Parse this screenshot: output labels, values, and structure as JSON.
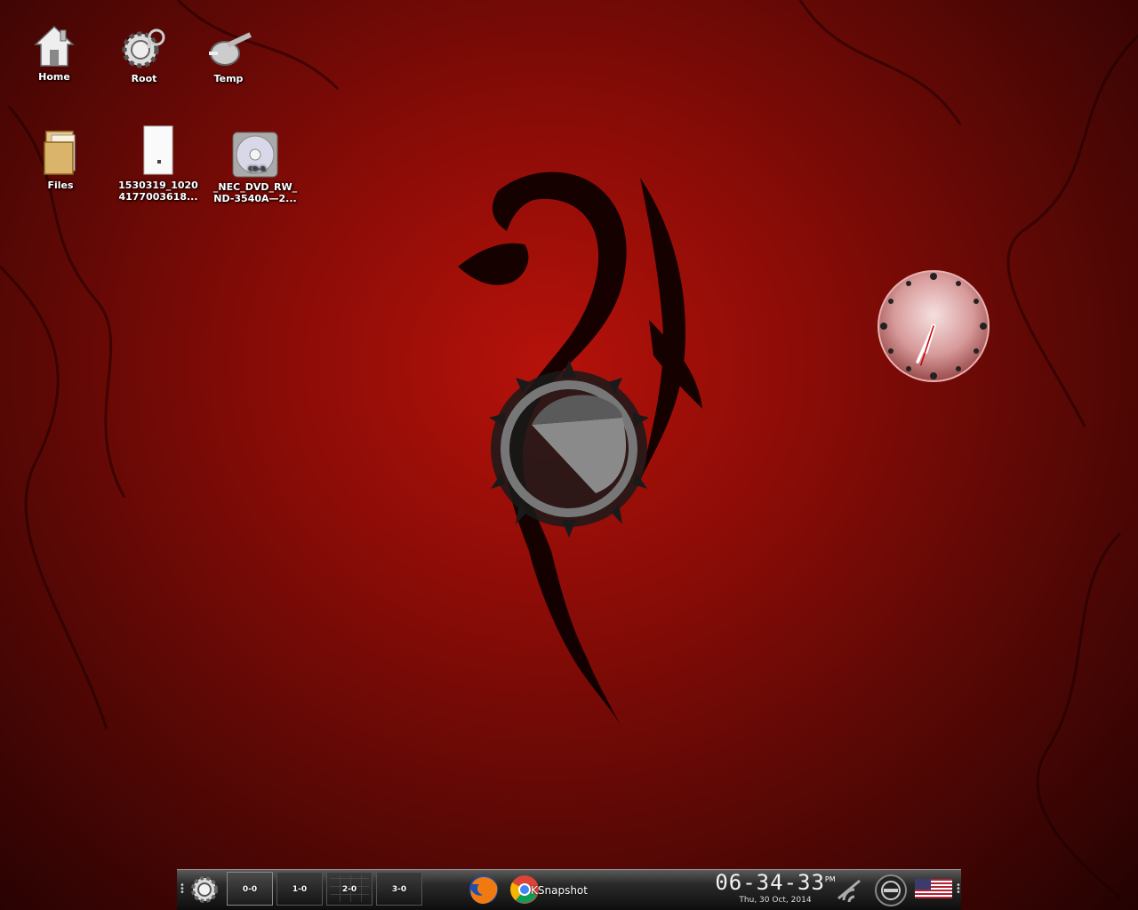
{
  "desktop": {
    "icons": [
      {
        "label": "Home"
      },
      {
        "label": "Root"
      },
      {
        "label": "Temp"
      },
      {
        "label": "Files"
      },
      {
        "label_line1": "1530319_1020",
        "label_line2": "4177003618..."
      },
      {
        "label_line1": "_NEC_DVD_RW_",
        "label_line2": "ND-3540A—2...",
        "disc_text": "CD-R"
      }
    ]
  },
  "panel": {
    "desktops": [
      "0-0",
      "1-0",
      "2-0",
      "3-0"
    ],
    "tasks": [
      "Firefox",
      "Chrome"
    ],
    "task_label": "KSnapshot",
    "clock": {
      "time": "06-34-33",
      "ampm": "PM",
      "date": "Thu, 30 Oct, 2014"
    },
    "tray": [
      "network-icon",
      "power-icon",
      "us-flag-icon"
    ]
  },
  "analog_clock": {
    "hour": 6,
    "minute": 34,
    "second": 33
  },
  "colors": {
    "wallpaper_red": "#8d0c07",
    "panel_dark": "#0e0e0e"
  }
}
